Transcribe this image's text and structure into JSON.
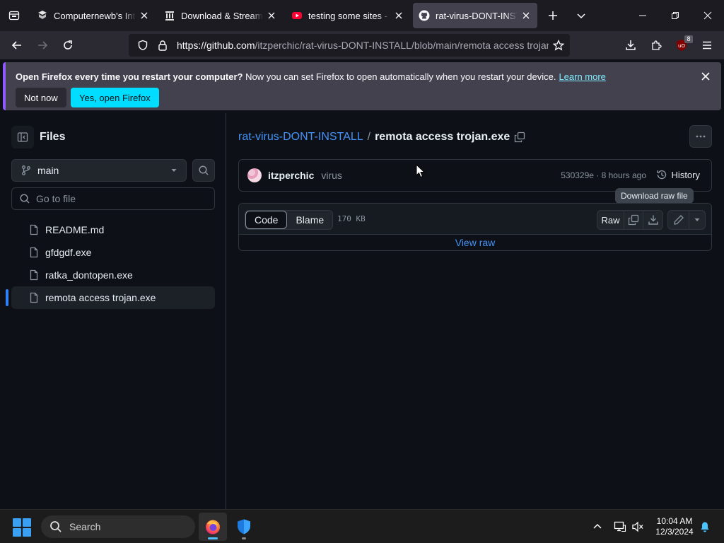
{
  "browser": {
    "tabs": [
      {
        "title": "Computernewb's Intern",
        "active": false
      },
      {
        "title": "Download & Streaming",
        "active": false
      },
      {
        "title": "testing some sites - Yo",
        "active": false
      },
      {
        "title": "rat-virus-DONT-INSTA",
        "active": true
      }
    ],
    "url_host": "https://github.com",
    "url_path": "/itzperchic/rat-virus-DONT-INSTALL/blob/main/remota access trojan",
    "extension_badge": "8",
    "notification": {
      "bold": "Open Firefox every time you restart your computer?",
      "text": "Now you can set Firefox to open automatically when you restart your device.",
      "link": "Learn more",
      "not_now": "Not now",
      "yes": "Yes, open Firefox"
    }
  },
  "github": {
    "sidebar": {
      "title": "Files",
      "branch": "main",
      "goto_placeholder": "Go to file",
      "files": [
        {
          "name": "README.md",
          "selected": false
        },
        {
          "name": "gfdgdf.exe",
          "selected": false
        },
        {
          "name": "ratka_dontopen.exe",
          "selected": false
        },
        {
          "name": "remota access trojan.exe",
          "selected": true
        }
      ]
    },
    "breadcrumb": {
      "repo": "rat-virus-DONT-INSTALL",
      "separator": "/",
      "file": "remota access trojan.exe"
    },
    "commit": {
      "author": "itzperchic",
      "message": "virus",
      "meta": "530329e · 8 hours ago",
      "history": "History"
    },
    "tooltip": "Download raw file",
    "file": {
      "tab_code": "Code",
      "tab_blame": "Blame",
      "size": "170 KB",
      "raw": "Raw",
      "view_raw": "View raw"
    }
  },
  "taskbar": {
    "search": "Search",
    "time": "10:04 AM",
    "date": "12/3/2024"
  },
  "colors": {
    "accent_link": "#4493f8",
    "firefox_cta": "#00ddff",
    "github_bg": "#0d1117"
  }
}
